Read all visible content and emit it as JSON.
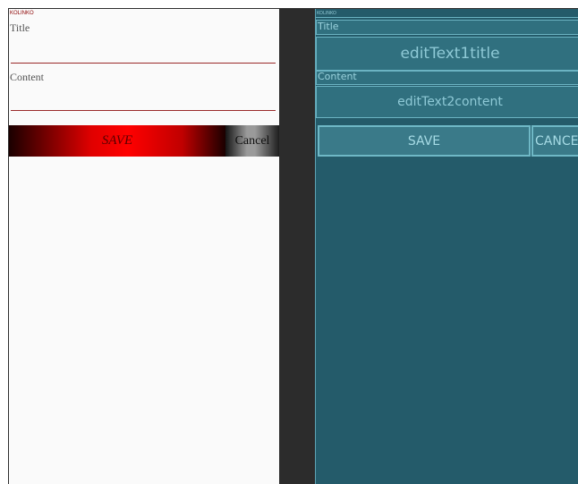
{
  "design_preview": {
    "app_name": "KOLINKO",
    "title_label": "Title",
    "content_label": "Content",
    "save_label": "SAVE",
    "cancel_label": "Cancel"
  },
  "blueprint_preview": {
    "app_name": "KOLINKO",
    "title_label": "Title",
    "title_field": "editText1title",
    "content_label": "Content",
    "content_field": "editText2content",
    "save_label": "SAVE",
    "cancel_label": "CANCEL"
  },
  "colors": {
    "preview_background": "#fafafa",
    "blueprint_background": "#245b6a",
    "divider": "#2c2c2c",
    "save_gradient_center": "#ff0000",
    "underline": "#9a2a2a"
  }
}
